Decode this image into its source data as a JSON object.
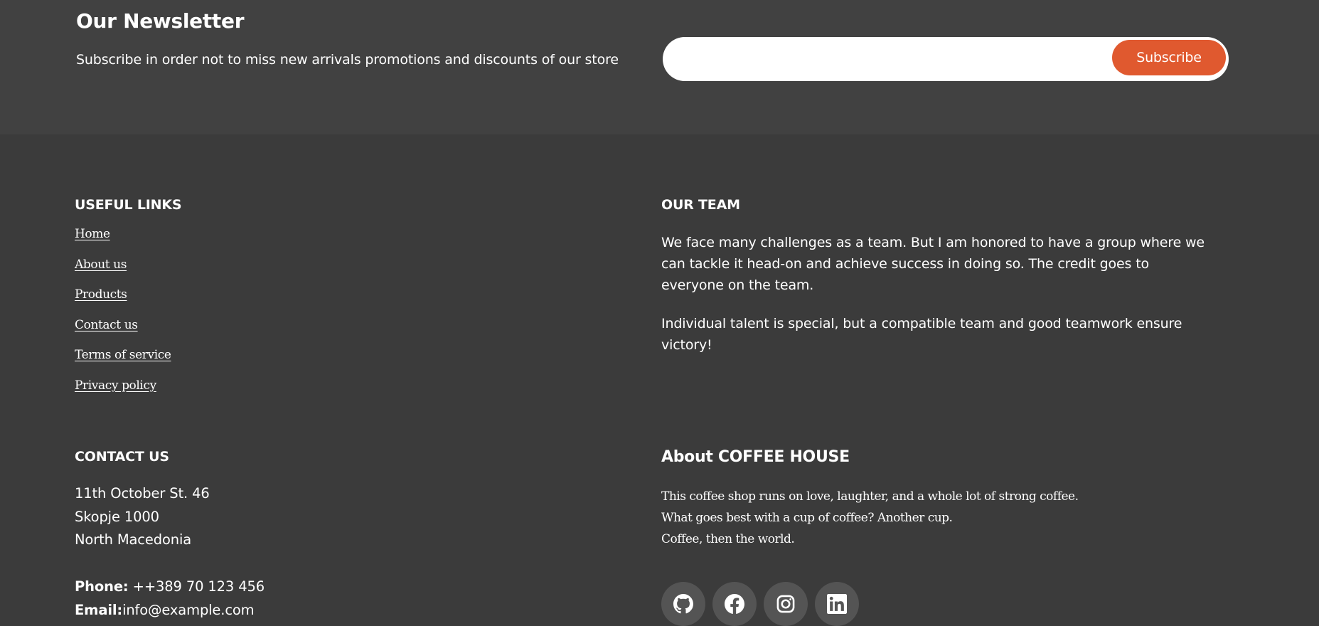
{
  "newsletter": {
    "title": "Our Newsletter",
    "description": "Subscribe in order not to miss new arrivals promotions and discounts of our store",
    "input_value": "",
    "button_label": "Subscribe"
  },
  "useful_links": {
    "heading": "USEFUL LINKS",
    "items": [
      "Home",
      "About us",
      "Products",
      "Contact us",
      "Terms of service",
      "Privacy policy"
    ]
  },
  "our_team": {
    "heading": "OUR TEAM",
    "paragraph1": "We face many challenges as a team. But I am honored to have a group where we can tackle it head-on and achieve success in doing so. The credit goes to everyone on the team.",
    "paragraph2": "Individual talent is special, but a compatible team and good teamwork ensure victory!"
  },
  "contact": {
    "heading": "CONTACT US",
    "address_line1": "11th October St. 46",
    "address_line2": "Skopje 1000",
    "address_line3": "North Macedonia",
    "phone_label": "Phone:",
    "phone_value": "++389 70 123 456",
    "email_label": "Email:",
    "email_value": "info@example.com"
  },
  "about": {
    "heading": "About COFFEE HOUSE",
    "line1": "This coffee shop runs on love, laughter, and a whole lot of strong coffee.",
    "line2": "What goes best with a cup of coffee? Another cup.",
    "line3": "Coffee, then the world."
  },
  "social_icons": [
    "github-icon",
    "facebook-icon",
    "instagram-icon",
    "linkedin-icon"
  ],
  "colors": {
    "page_background": "#3b3b3b",
    "newsletter_background": "#414141",
    "accent": "#e0592f",
    "social_circle": "#545454",
    "text": "#ffffff"
  }
}
